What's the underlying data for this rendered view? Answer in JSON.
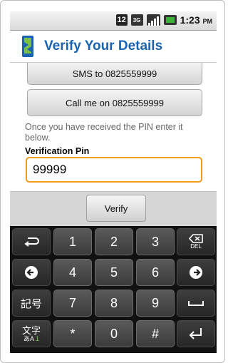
{
  "status_bar": {
    "notification_count": "12",
    "network_type": "3G",
    "time": "1:23",
    "ampm": "PM"
  },
  "header": {
    "title": "Verify Your Details"
  },
  "actions": {
    "sms_label": "SMS to 0825559999",
    "call_label": "Call me on 0825559999"
  },
  "form": {
    "instructions": "Once you have received the PIN enter it below.",
    "pin_label": "Verification Pin",
    "pin_value": "99999",
    "verify_label": "Verify"
  },
  "keyboard": {
    "row1": [
      "1",
      "2",
      "3"
    ],
    "row2": [
      "4",
      "5",
      "6"
    ],
    "row3": [
      "7",
      "8",
      "9"
    ],
    "row4": [
      "*",
      "0",
      "#"
    ],
    "del_label": "DEL",
    "symbols_label": "記号",
    "input_mode_main": "文字",
    "input_mode_sub_a": "あA",
    "input_mode_sub_b": "1"
  },
  "colors": {
    "title": "#1a63b0",
    "input_focus_border": "#f29a1f",
    "battery": "#3cb13c"
  },
  "icons": {
    "header_logo": "app-logo-icon",
    "back_key": "back-arrow-icon",
    "delete_key": "delete-icon",
    "left_key": "left-arrow-icon",
    "right_key": "right-arrow-icon",
    "space_key": "space-icon",
    "enter_key": "enter-icon"
  }
}
